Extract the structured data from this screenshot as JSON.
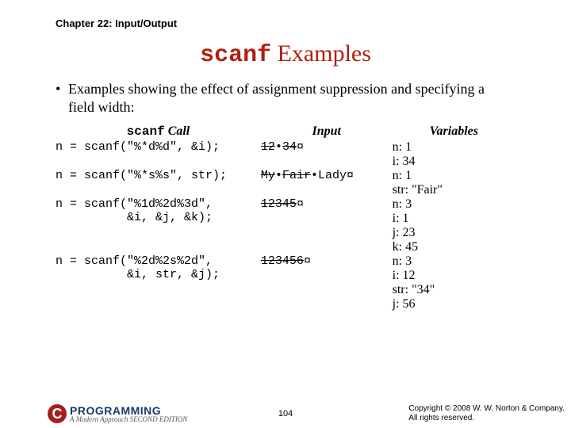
{
  "chapter": "Chapter 22: Input/Output",
  "title": {
    "mono": "scanf",
    "rest": " Examples"
  },
  "bullet": "Examples showing the effect of assignment suppression and specifying a field width:",
  "headers": {
    "call_mono": "scanf",
    "call_suffix": " Call",
    "input": "Input",
    "vars": "Variables"
  },
  "rows": [
    {
      "call": "n = scanf(\"%*d%d\", &i);",
      "input_pre_strike": "12",
      "input_mid": "•",
      "input_post_strike": "34",
      "input_tail": "¤",
      "vars": "n: 1\ni: 34"
    },
    {
      "call": "n = scanf(\"%*s%s\", str);",
      "input_pre_strike": "My",
      "input_mid": "•",
      "input_post_strike": "Fair",
      "input_tail": "•Lady¤",
      "vars": "n: 1\nstr: \"Fair\""
    },
    {
      "call": "n = scanf(\"%1d%2d%3d\",\n          &i, &j, &k);",
      "input_pre_strike": "12345",
      "input_mid": "",
      "input_post_strike": "",
      "input_tail": "¤",
      "vars": "n: 3\ni: 1\nj: 23\nk: 45"
    },
    {
      "call": "n = scanf(\"%2d%2s%2d\",\n          &i, str, &j);",
      "input_pre_strike": "123456",
      "input_mid": "",
      "input_post_strike": "",
      "input_tail": "¤",
      "vars": "n: 3\ni: 12\nstr: \"34\"\nj: 56"
    }
  ],
  "footer": {
    "logo_letter": "C",
    "logo_word": "PROGRAMMING",
    "logo_sub": "A Modern Approach   SECOND EDITION",
    "page": "104",
    "copyright_l1": "Copyright © 2008 W. W. Norton & Company.",
    "copyright_l2": "All rights reserved."
  }
}
